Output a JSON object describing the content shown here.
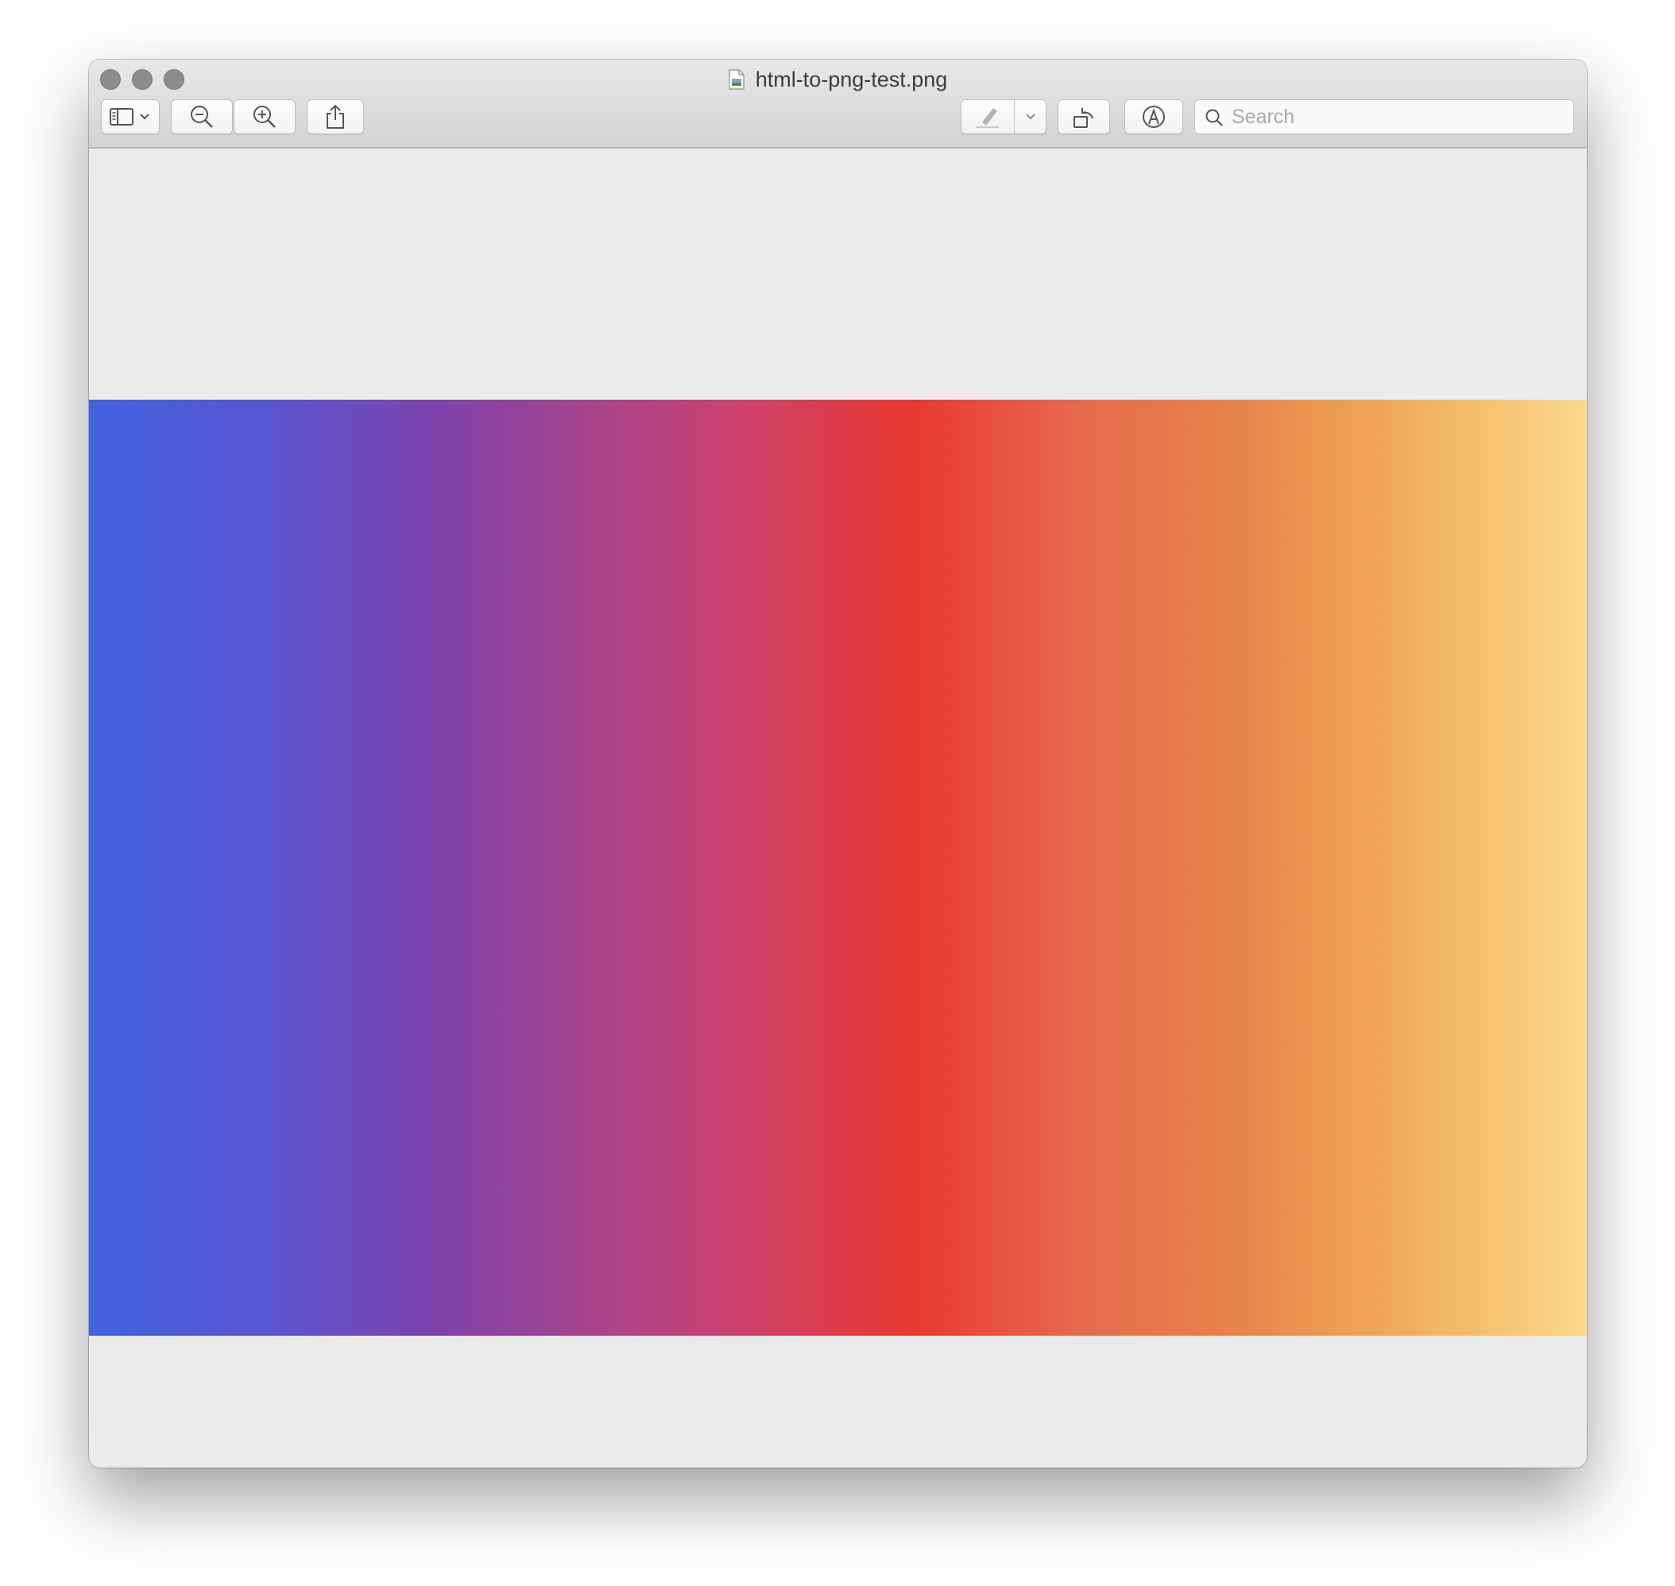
{
  "window": {
    "title": "html-to-png-test.png",
    "traffic_lights": [
      "close",
      "minimize",
      "zoom"
    ]
  },
  "toolbar": {
    "sidebar_button_icon": "sidebar-icon",
    "zoom_out_icon": "zoom-out-icon",
    "zoom_in_icon": "zoom-in-icon",
    "share_icon": "share-icon",
    "markup_pen_icon": "pen-icon",
    "rotate_icon": "rotate-left-icon",
    "annotate_icon": "markup-icon"
  },
  "search": {
    "placeholder": "Search",
    "value": ""
  },
  "image": {
    "gradient_stops": [
      {
        "color": "#4163e0",
        "pos": 0
      },
      {
        "color": "#5a55d2",
        "pos": 0.12
      },
      {
        "color": "#7d43ab",
        "pos": 0.23
      },
      {
        "color": "#ae4488",
        "pos": 0.35
      },
      {
        "color": "#ce416b",
        "pos": 0.44
      },
      {
        "color": "#e9392f",
        "pos": 0.55
      },
      {
        "color": "#e66a4b",
        "pos": 0.66
      },
      {
        "color": "#e8844b",
        "pos": 0.77
      },
      {
        "color": "#f0ae59",
        "pos": 0.88
      },
      {
        "color": "#fad98c",
        "pos": 1
      }
    ]
  }
}
